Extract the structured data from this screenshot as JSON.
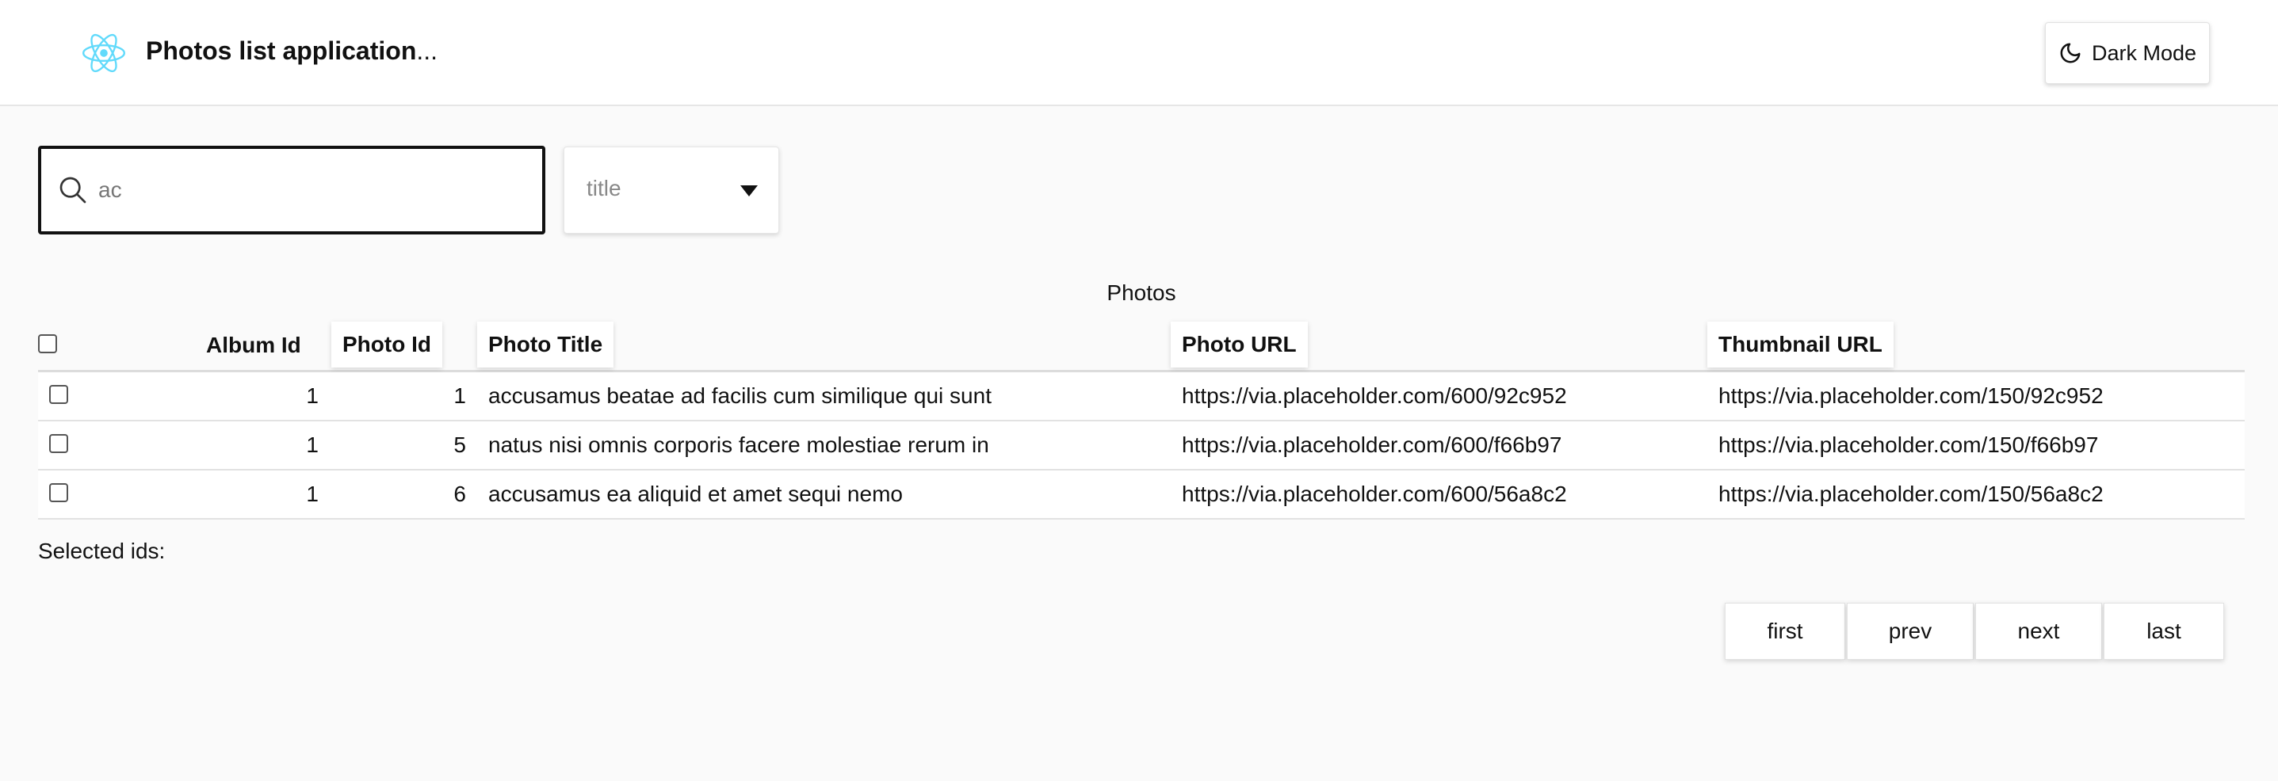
{
  "header": {
    "title_strong": "Photos list application",
    "title_suffix": "...",
    "dark_mode_label": "Dark Mode",
    "logo_icon": "react-logo-icon",
    "logo_color": "#61dafb"
  },
  "search": {
    "value": "ac",
    "placeholder": "",
    "icon": "search-icon"
  },
  "filter_select": {
    "value": "title"
  },
  "table": {
    "caption": "Photos",
    "columns": [
      "Album Id",
      "Photo Id",
      "Photo Title",
      "Photo URL",
      "Thumbnail URL"
    ],
    "rows": [
      {
        "album_id": "1",
        "photo_id": "1",
        "title": "accusamus beatae ad facilis cum similique qui sunt",
        "url": "https://via.placeholder.com/600/92c952",
        "thumb": "https://via.placeholder.com/150/92c952"
      },
      {
        "album_id": "1",
        "photo_id": "5",
        "title": "natus nisi omnis corporis facere molestiae rerum in",
        "url": "https://via.placeholder.com/600/f66b97",
        "thumb": "https://via.placeholder.com/150/f66b97"
      },
      {
        "album_id": "1",
        "photo_id": "6",
        "title": "accusamus ea aliquid et amet sequi nemo",
        "url": "https://via.placeholder.com/600/56a8c2",
        "thumb": "https://via.placeholder.com/150/56a8c2"
      }
    ]
  },
  "selected_ids_label": "Selected ids:",
  "pagination": {
    "first": "first",
    "prev": "prev",
    "next": "next",
    "last": "last"
  }
}
